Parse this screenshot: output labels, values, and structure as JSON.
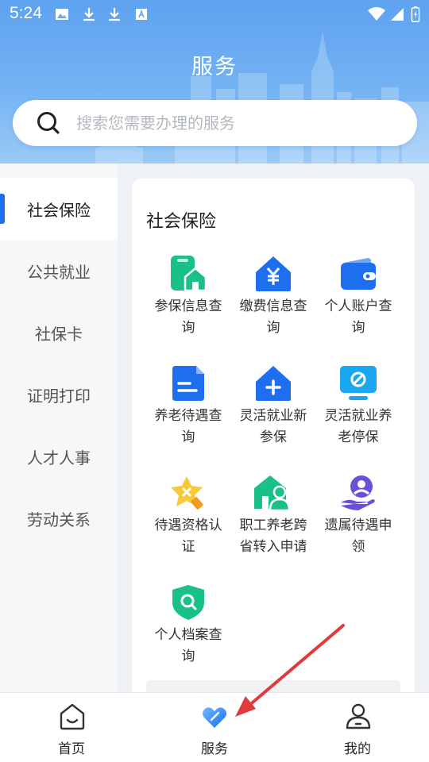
{
  "status_bar": {
    "time": "5:24"
  },
  "header": {
    "title": "服务",
    "search_placeholder": "搜索您需要办理的服务"
  },
  "sidebar": {
    "items": [
      {
        "label": "社会保险",
        "active": true
      },
      {
        "label": "公共就业",
        "active": false
      },
      {
        "label": "社保卡",
        "active": false
      },
      {
        "label": "证明打印",
        "active": false
      },
      {
        "label": "人才人事",
        "active": false
      },
      {
        "label": "劳动关系",
        "active": false
      }
    ]
  },
  "section": {
    "title": "社会保险",
    "services": [
      {
        "line1": "参保信息查",
        "line2": "询",
        "icon": "insurance-info-icon",
        "color": "#19c08a"
      },
      {
        "line1": "缴费信息查",
        "line2": "询",
        "icon": "payment-info-icon",
        "color": "#1e6ff0"
      },
      {
        "line1": "个人账户查",
        "line2": "询",
        "icon": "wallet-icon",
        "color": "#1e6ff0"
      },
      {
        "line1": "养老待遇查",
        "line2": "询",
        "icon": "pension-document-icon",
        "color": "#1e6ff0"
      },
      {
        "line1": "灵活就业新",
        "line2": "参保",
        "icon": "house-plus-icon",
        "color": "#1e6ff0"
      },
      {
        "line1": "灵活就业养",
        "line2": "老停保",
        "icon": "monitor-stop-icon",
        "color": "#1aa7f0"
      },
      {
        "line1": "待遇资格认",
        "line2": "证",
        "icon": "star-badge-icon",
        "color": "#f7b926"
      },
      {
        "line1": "职工养老跨",
        "line2": "省转入申请",
        "icon": "person-house-icon",
        "color": "#19c08a"
      },
      {
        "line1": "遗属待遇申",
        "line2": "领",
        "icon": "hand-person-icon",
        "color": "#6b4fd8"
      },
      {
        "line1": "个人档案查",
        "line2": "询",
        "icon": "shield-search-icon",
        "color": "#19c08a"
      }
    ]
  },
  "tabbar": {
    "tabs": [
      {
        "label": "首页",
        "icon": "home-icon"
      },
      {
        "label": "服务",
        "icon": "service-heart-icon",
        "active": true
      },
      {
        "label": "我的",
        "icon": "profile-icon"
      }
    ]
  },
  "colors": {
    "accent": "#1e6ff0",
    "header_top": "#5ea2ef",
    "header_bottom": "#9bcaf6",
    "annotation_arrow": "#e03a3a"
  }
}
